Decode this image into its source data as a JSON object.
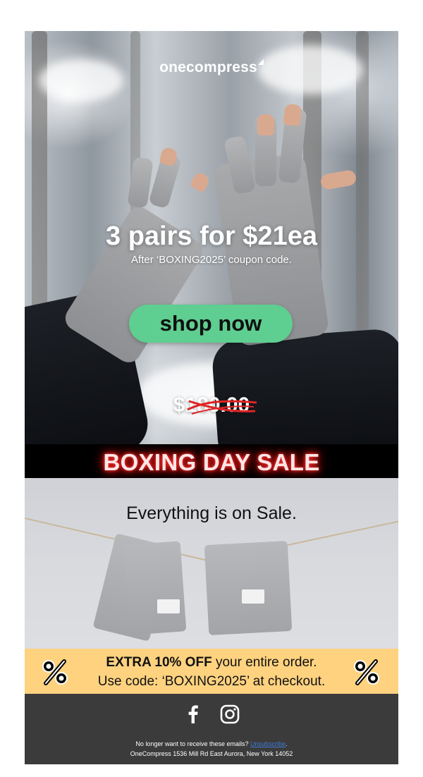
{
  "hero": {
    "logo": "onecompress",
    "title": "3 pairs for $21ea",
    "subtitle": "After ‘BOXING2025’ coupon code.",
    "cta_label": "shop now",
    "old_price": "$180.00"
  },
  "banner": {
    "text": "BOXING DAY SALE"
  },
  "sale_section": {
    "title": "Everything is on Sale."
  },
  "extra_offer": {
    "line1_bold": "EXTRA 10% OFF",
    "line1_rest": " your entire order.",
    "line2": "Use code: ‘BOXING2025’ at checkout."
  },
  "footer": {
    "social": [
      "facebook-icon",
      "instagram-icon"
    ],
    "unsubscribe_prompt": "No longer want to receive these emails? ",
    "unsubscribe_link": "Unsubscribe",
    "unsubscribe_end": ".",
    "address": "OneCompress 1536 Mill Rd East Aurora, New York 14052"
  },
  "colors": {
    "cta": "#5fce91",
    "banner_bg": "#000000",
    "banner_glow": "#ff2020",
    "offer_bg": "#ffd27f",
    "footer_bg": "#3b3b3b",
    "link": "#3d7bd8"
  }
}
